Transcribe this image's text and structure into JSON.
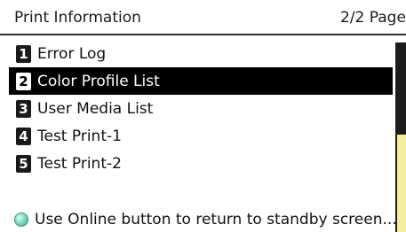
{
  "header": {
    "title": "Print Information",
    "page_indicator": "2/2 Page"
  },
  "menu": {
    "items": [
      {
        "number": "1",
        "label": "Error Log",
        "selected": false
      },
      {
        "number": "2",
        "label": "Color Profile List",
        "selected": true
      },
      {
        "number": "3",
        "label": "User Media List",
        "selected": false
      },
      {
        "number": "4",
        "label": "Test Print-1",
        "selected": false
      },
      {
        "number": "5",
        "label": "Test Print-2",
        "selected": false
      }
    ]
  },
  "footer": {
    "icon": "online-button-icon",
    "text": "Use Online button to return to standby screen..."
  },
  "colors": {
    "selected_background": "#000000",
    "scroll_thumb": "#f3ef9f",
    "scroll_track": "#1c1c1c",
    "online_icon": "#7fe0c4"
  },
  "scrollbar": {
    "position_fraction": 0.5
  }
}
